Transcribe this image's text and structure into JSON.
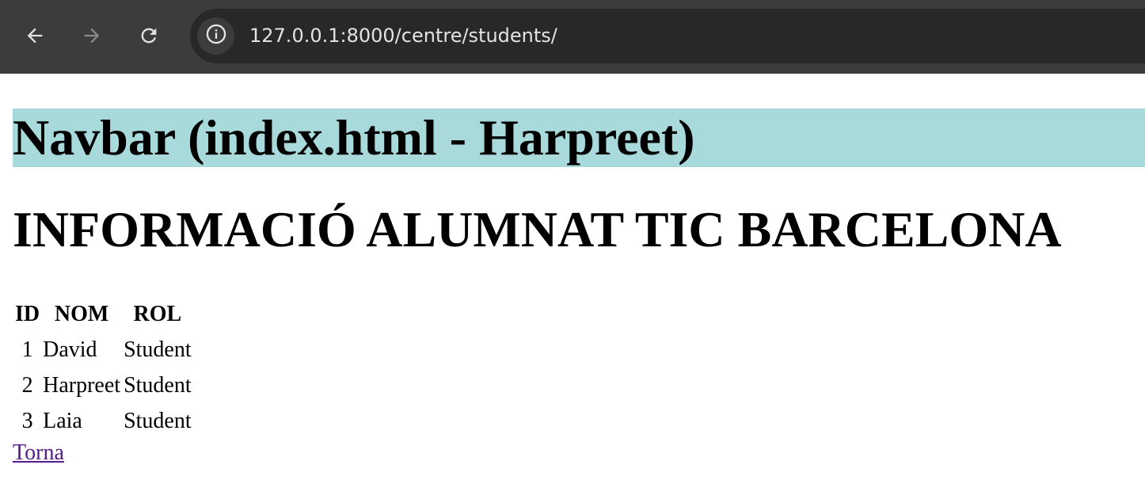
{
  "browser": {
    "url_host": "127.0.0.1",
    "url_path": ":8000/centre/students/",
    "icons": {
      "back": "back-arrow-icon",
      "forward": "forward-arrow-icon",
      "reload": "reload-icon",
      "site_info": "info-icon"
    }
  },
  "navbar": {
    "title": "Navbar (index.html - Harpreet)",
    "background": "#a8dadc"
  },
  "main": {
    "title": "INFORMACIÓ ALUMNAT TIC BARCELONA",
    "table": {
      "headers": [
        "ID",
        "NOM",
        "ROL"
      ],
      "rows": [
        {
          "id": "1",
          "nom": "David",
          "rol": "Student"
        },
        {
          "id": "2",
          "nom": "Harpreet",
          "rol": "Student"
        },
        {
          "id": "3",
          "nom": "Laia",
          "rol": "Student"
        }
      ]
    },
    "back_link": "Torna",
    "link_color": "#551a8b"
  }
}
